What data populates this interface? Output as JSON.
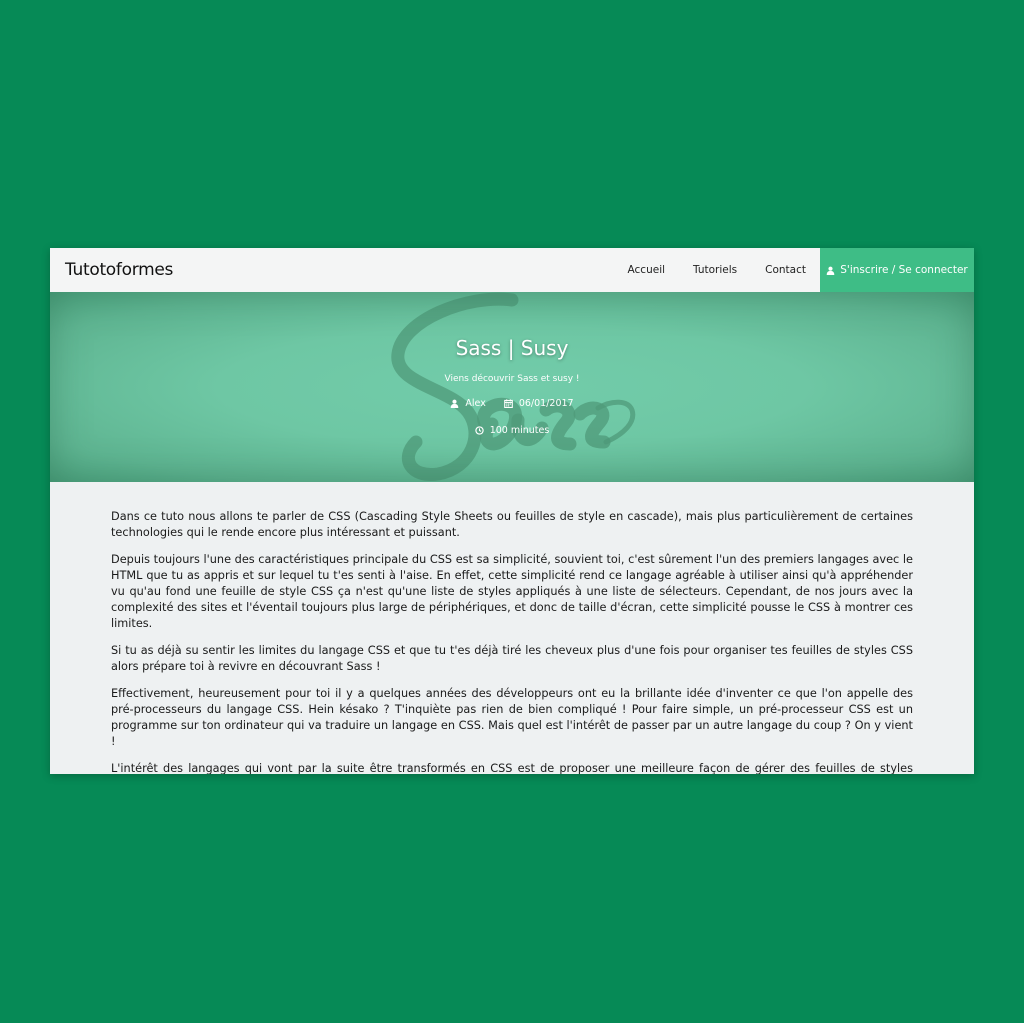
{
  "nav": {
    "brand": "Tutotoformes",
    "links": [
      "Accueil",
      "Tutoriels",
      "Contact"
    ],
    "cta_label": "S'inscrire / Se connecter"
  },
  "hero": {
    "title": "Sass | Susy",
    "subtitle": "Viens découvrir Sass et susy !",
    "author": "Alex",
    "date": "06/01/2017",
    "duration": "100 minutes",
    "logo_text": "Sass"
  },
  "article": {
    "paragraphs": [
      "Dans ce tuto nous allons te parler de CSS (Cascading Style Sheets ou feuilles de style en cascade), mais plus particulièrement de certaines technologies qui le rende encore plus intéressant et puissant.",
      "Depuis toujours l'une des caractéristiques principale du CSS est sa simplicité, souvient toi, c'est sûrement l'un des premiers langages avec le HTML que tu as appris et sur lequel tu t'es senti à l'aise. En effet, cette simplicité rend ce langage agréable à utiliser ainsi qu'à appréhender vu qu'au fond une feuille de style CSS ça n'est qu'une liste de styles appliqués à une liste de sélecteurs. Cependant, de nos jours avec la complexité des sites et l'éventail toujours plus large de périphériques, et donc de taille d'écran, cette simplicité pousse le CSS à montrer ces limites.",
      "Si tu as déjà su sentir les limites du langage CSS et que tu t'es déjà tiré les cheveux plus d'une fois pour organiser tes feuilles de styles CSS alors prépare toi à revivre en découvrant Sass !",
      "Effectivement, heureusement pour toi il y a quelques années des développeurs ont eu la brillante idée d'inventer ce que l'on appelle des pré-processeurs du langage CSS. Hein késako ? T'inquiète pas rien de bien compliqué ! Pour faire simple, un pré-processeur CSS est un programme sur ton ordinateur qui va traduire un langage en CSS. Mais quel est l'intérêt de passer par un autre langage du coup ? On y vient !",
      "L'intérêt des langages qui vont par la suite être transformés en CSS est de proposer une meilleure façon de gérer des feuilles de styles complexes en offrant une nouvelle syntaxe. Et c'est cette nouvelle syntaxe de feuille de style qui va être traduite en CSS par le préprocesseur afin"
    ]
  },
  "colors": {
    "background": "#068a56",
    "accent": "#3ebd86",
    "hero": "#6ec7a4"
  },
  "icons": {
    "cta": "user-icon",
    "author": "user-icon",
    "date": "calendar-icon",
    "duration": "clock-icon"
  }
}
